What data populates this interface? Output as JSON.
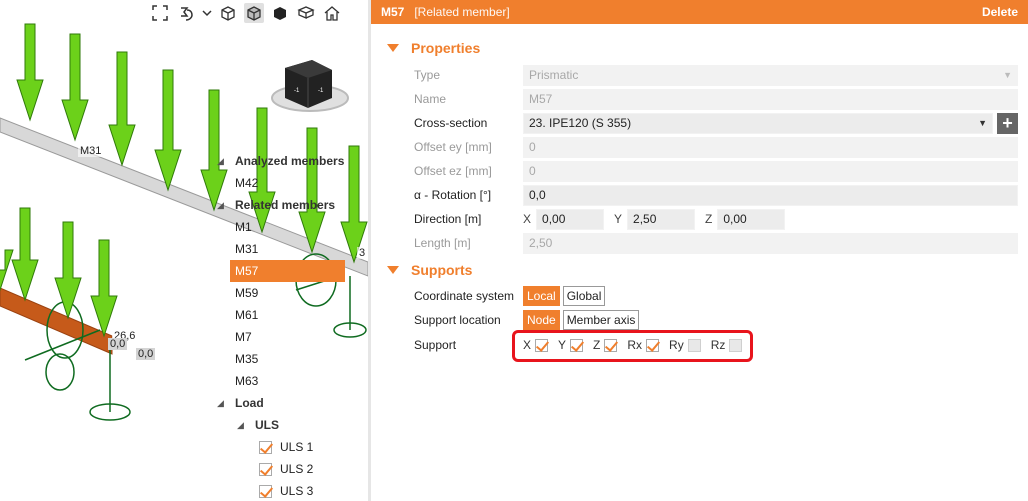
{
  "panel": {
    "member_name": "M57",
    "member_type": "[Related member]",
    "delete_label": "Delete",
    "properties_title": "Properties",
    "supports_title": "Supports",
    "rows": {
      "type": {
        "label": "Type",
        "value": "Prismatic"
      },
      "name": {
        "label": "Name",
        "value": "M57"
      },
      "cross_section": {
        "label": "Cross-section",
        "value": "23. IPE120 (S 355)"
      },
      "offset_ey": {
        "label": "Offset ey [mm]",
        "value": "0"
      },
      "offset_ez": {
        "label": "Offset ez [mm]",
        "value": "0"
      },
      "rotation": {
        "label": "α - Rotation [°]",
        "value": "0,0"
      },
      "direction": {
        "label": "Direction [m]",
        "x_label": "X",
        "x": "0,00",
        "y_label": "Y",
        "y": "2,50",
        "z_label": "Z",
        "z": "0,00"
      },
      "length": {
        "label": "Length [m]",
        "value": "2,50"
      }
    },
    "supports": {
      "coordinate_system": {
        "label": "Coordinate system",
        "options": [
          "Local",
          "Global"
        ],
        "selected": "Local"
      },
      "support_location": {
        "label": "Support location",
        "options": [
          "Node",
          "Member axis"
        ],
        "selected": "Node"
      },
      "support": {
        "label": "Support",
        "items": [
          {
            "label": "X",
            "checked": true
          },
          {
            "label": "Y",
            "checked": true
          },
          {
            "label": "Z",
            "checked": true
          },
          {
            "label": "Rx",
            "checked": true
          },
          {
            "label": "Ry",
            "checked": false
          },
          {
            "label": "Rz",
            "checked": false
          }
        ]
      }
    }
  },
  "tree": {
    "analyzed_header": "Analyzed members",
    "analyzed_items": [
      "M42"
    ],
    "related_header": "Related members",
    "related_items": [
      "M1",
      "M31",
      "M57",
      "M59",
      "M61",
      "M7",
      "M35",
      "M63"
    ],
    "selected": "M57",
    "load_header": "Load",
    "load_group": "ULS",
    "load_items": [
      {
        "label": "ULS 1",
        "checked": true
      },
      {
        "label": "ULS 2",
        "checked": true
      },
      {
        "label": "ULS 3",
        "checked": true
      }
    ]
  },
  "scene": {
    "member_label": "M31",
    "value_labels": [
      "26,6",
      "0,0",
      "0,0",
      "3"
    ],
    "cube_faces": [
      "-1",
      "-1"
    ]
  },
  "colors": {
    "accent": "#f07f2d",
    "load_arrow": "#6cd11a",
    "support_green": "#0f6b20",
    "highlight_red": "#e8141c"
  },
  "icons": [
    "fullscreen-icon",
    "rotate-icon",
    "chevron-down-icon",
    "cube-wireframe-icon",
    "cube-shaded-icon",
    "cube-solid-icon",
    "section-view-icon",
    "home-icon"
  ]
}
